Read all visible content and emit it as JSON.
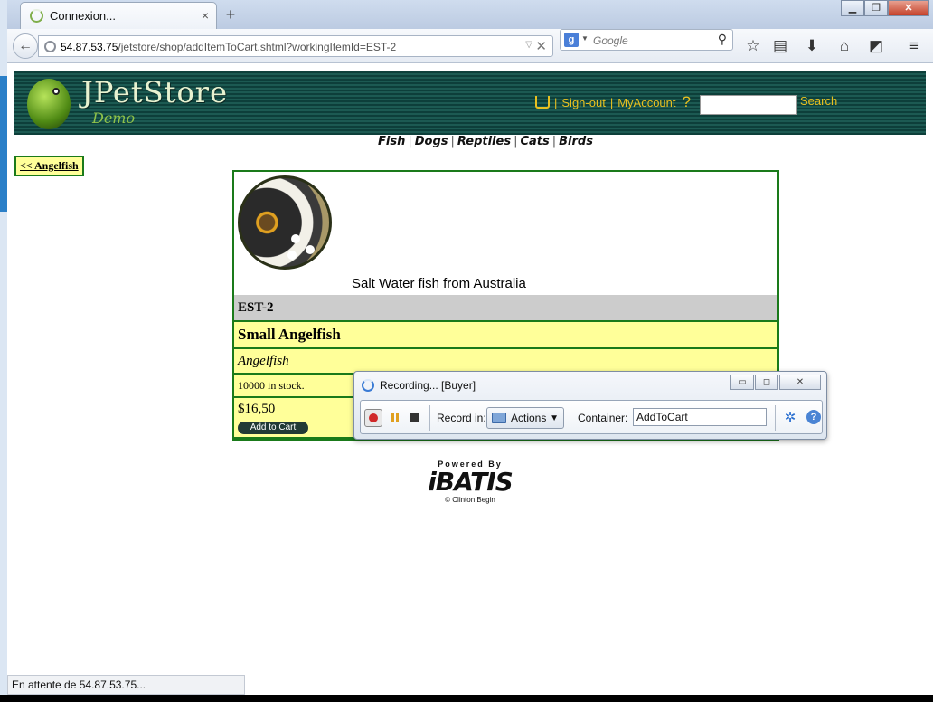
{
  "browser": {
    "tab_title": "Connexion...",
    "tab_close": "×",
    "new_tab": "+",
    "url_host": "54.87.53.75",
    "url_path": "/jetstore/shop/addItemToCart.shtml?workingItemId=EST-2",
    "search_placeholder": "Google",
    "status_text": "En attente de 54.87.53.75..."
  },
  "header": {
    "logo_title": "JPetStore",
    "logo_subtitle": "Demo",
    "sign_out": "Sign-out",
    "my_account": "MyAccount",
    "help": "?",
    "search_button": "Search"
  },
  "categories": [
    "Fish",
    "Dogs",
    "Reptiles",
    "Cats",
    "Birds"
  ],
  "back_link": "<< Angelfish",
  "item": {
    "image_caption": "Salt Water fish from Australia",
    "id": "EST-2",
    "name": "Small Angelfish",
    "attribute": "Angelfish",
    "stock": "10000 in stock.",
    "price": "$16,50",
    "add_to_cart": "Add to Cart"
  },
  "footer": {
    "powered_by": "Powered By",
    "brand": "iBATIS",
    "copyright": "© Clinton Begin"
  },
  "recorder": {
    "title": "Recording... [Buyer]",
    "record_in_label": "Record in:",
    "record_in_value": "Actions",
    "container_label": "Container:",
    "container_value": "AddToCart"
  }
}
